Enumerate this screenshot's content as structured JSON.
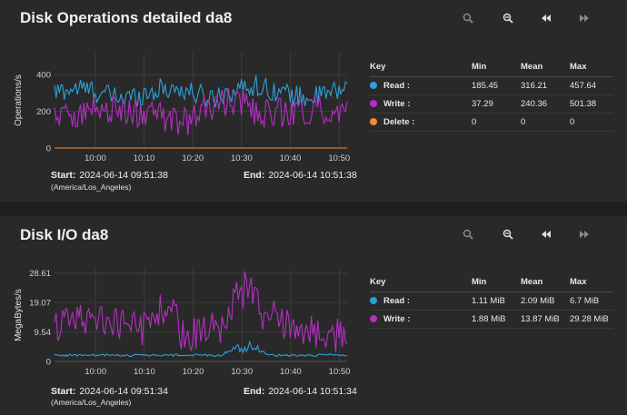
{
  "charts": [
    {
      "title": "Disk Operations detailed da8",
      "ylabel": "Operations/s",
      "start_label": "Start:",
      "start": "2024-06-14 09:51:38",
      "timezone": "(America/Los_Angeles)",
      "end_label": "End:",
      "end": "2024-06-14 10:51:38",
      "table": {
        "headers": [
          "Key",
          "Min",
          "Mean",
          "Max"
        ],
        "rows": [
          {
            "key": "Read :",
            "color": "#2f9fd8",
            "min": "185.45",
            "mean": "316.21",
            "max": "457.64"
          },
          {
            "key": "Write :",
            "color": "#b52fc4",
            "min": "37.29",
            "mean": "240.36",
            "max": "501.38"
          },
          {
            "key": "Delete :",
            "color": "#f08a33",
            "min": "0",
            "mean": "0",
            "max": "0"
          }
        ]
      },
      "chart_data": {
        "type": "line",
        "title": "Disk Operations detailed da8",
        "ylabel": "Operations/s",
        "x_ticks": [
          "10:00",
          "10:10",
          "10:20",
          "10:30",
          "10:40",
          "10:50"
        ],
        "y_ticks": [
          "0",
          "200",
          "400"
        ],
        "ylim": [
          0,
          520
        ],
        "x_range": [
          "09:51:38",
          "10:51:38"
        ],
        "series": [
          {
            "name": "Read",
            "color": "#2f9fd8",
            "min": 185.45,
            "mean": 316.21,
            "max": 457.64
          },
          {
            "name": "Write",
            "color": "#b52fc4",
            "min": 37.29,
            "mean": 240.36,
            "max": 501.38
          },
          {
            "name": "Delete",
            "color": "#f08a33",
            "min": 0,
            "mean": 0,
            "max": 0
          }
        ]
      }
    },
    {
      "title": "Disk I/O da8",
      "ylabel": "MegaBytes/s",
      "start_label": "Start:",
      "start": "2024-06-14 09:51:34",
      "timezone": "(America/Los_Angeles)",
      "end_label": "End:",
      "end": "2024-06-14 10:51:34",
      "table": {
        "headers": [
          "Key",
          "Min",
          "Mean",
          "Max"
        ],
        "rows": [
          {
            "key": "Read :",
            "color": "#2f9fd8",
            "min": "1.11 MiB",
            "mean": "2.09 MiB",
            "max": "6.7 MiB"
          },
          {
            "key": "Write :",
            "color": "#b52fc4",
            "min": "1.88 MiB",
            "mean": "13.87 MiB",
            "max": "29.28 MiB"
          }
        ]
      },
      "chart_data": {
        "type": "line",
        "title": "Disk I/O da8",
        "ylabel": "MegaBytes/s",
        "x_ticks": [
          "10:00",
          "10:10",
          "10:20",
          "10:30",
          "10:40",
          "10:50"
        ],
        "y_ticks": [
          "0",
          "9.54",
          "19.07",
          "28.61"
        ],
        "ylim": [
          0,
          30
        ],
        "x_range": [
          "09:51:34",
          "10:51:34"
        ],
        "series": [
          {
            "name": "Read",
            "color": "#2f9fd8",
            "min": 1.11,
            "mean": 2.09,
            "max": 6.7
          },
          {
            "name": "Write",
            "color": "#b52fc4",
            "min": 1.88,
            "mean": 13.87,
            "max": 29.28
          }
        ]
      }
    }
  ],
  "toolbar_icons": [
    "zoom-in-icon",
    "zoom-out-icon",
    "rewind-icon",
    "fast-forward-icon"
  ]
}
